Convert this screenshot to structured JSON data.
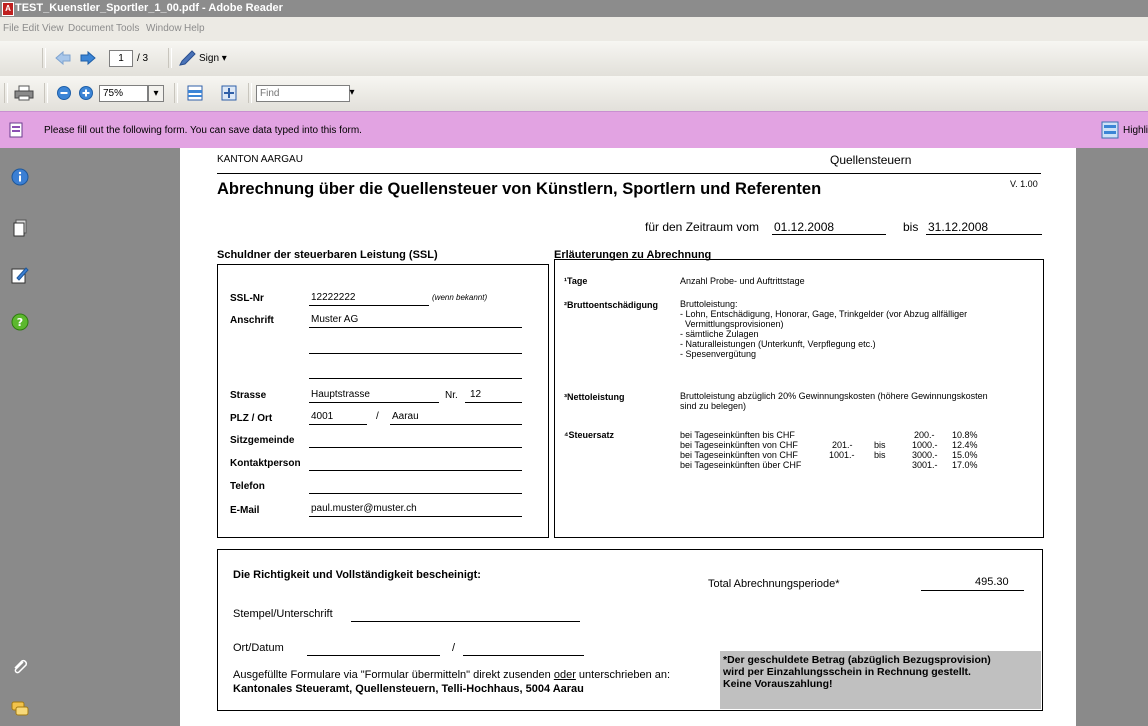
{
  "window": {
    "title": "TEST_Kuenstler_Sportler_1_00.pdf - Adobe Reader"
  },
  "menu": [
    "File",
    "Edit",
    "View",
    "Document",
    "Tools",
    "Window",
    "Help"
  ],
  "toolbar": {
    "page_current": "1",
    "page_total": "/ 3",
    "sign_label": "Sign",
    "zoom": "75%",
    "find_placeholder": "Find"
  },
  "notification": {
    "text": "Please fill out the following form. You can save data typed into this form.",
    "highlight_label": "Highli"
  },
  "form": {
    "canton": "KANTON AARGAU",
    "department": "Quellensteuern",
    "version": "V. 1.00",
    "title": "Abrechnung über die Quellensteuer von Künstlern, Sportlern und Referenten",
    "period_label": "für den Zeitraum vom",
    "period_from": "01.12.2008",
    "period_bis": "bis",
    "period_to": "31.12.2008",
    "debtor": {
      "heading": "Schuldner der steuerbaren Leistung (SSL)",
      "ssl_label": "SSL-Nr",
      "ssl_value": "12222222",
      "ssl_hint": "(wenn bekannt)",
      "address_label": "Anschrift",
      "address_value": "Muster AG",
      "street_label": "Strasse",
      "street_value": "Hauptstrasse",
      "nr_label": "Nr.",
      "nr_value": "12",
      "plz_label": "PLZ / Ort",
      "plz_value": "4001",
      "slash": "/",
      "city_value": "Aarau",
      "municipality_label": "Sitzgemeinde",
      "contact_label": "Kontaktperson",
      "phone_label": "Telefon",
      "email_label": "E-Mail",
      "email_value": "paul.muster@muster.ch"
    },
    "explanations": {
      "heading": "Erläuterungen zu Abrechnung",
      "tage_label": "¹Tage",
      "tage_text": "Anzahl Probe- und Auftrittstage",
      "brutto_label": "²Bruttoentschädigung",
      "brutto_lines": [
        "Bruttoleistung:",
        "- Lohn, Entschädigung, Honorar, Gage, Trinkgelder (vor Abzug allfälliger",
        "  Vermittlungsprovisionen)",
        "- sämtliche Zulagen",
        "- Naturalleistungen (Unterkunft, Verpflegung etc.)",
        "- Spesenvergütung"
      ],
      "netto_label": "³Nettoleistung",
      "netto_lines": [
        "Bruttoleistung abzüglich 20% Gewinnungskosten (höhere Gewinnungskosten",
        "sind zu belegen)"
      ],
      "steuer_label": "⁴Steuersatz",
      "rates": [
        {
          "text": "bei Tageseinkünften bis CHF",
          "from": "",
          "bis": "",
          "to": "200.-",
          "rate": "10.8%"
        },
        {
          "text": "bei Tageseinkünften von CHF",
          "from": "201.-",
          "bis": "bis",
          "to": "1000.-",
          "rate": "12.4%"
        },
        {
          "text": "bei Tageseinkünften von CHF",
          "from": "1001.-",
          "bis": "bis",
          "to": "3000.-",
          "rate": "15.0%"
        },
        {
          "text": "bei Tageseinkünften über CHF",
          "from": "",
          "bis": "",
          "to": "3001.-",
          "rate": "17.0%"
        }
      ]
    },
    "cert": {
      "heading": "Die Richtigkeit und Vollständigkeit bescheinigt:",
      "total_label": "Total Abrechnungsperiode*",
      "total_value": "495.30",
      "stamp_label": "Stempel/Unterschrift",
      "place_label": "Ort/Datum",
      "slash": "/",
      "send_pre": "Ausgefüllte Formulare via \"Formular übermitteln\" direkt zusenden ",
      "send_oder": "oder",
      "send_post": " unterschrieben an:",
      "address": "Kantonales Steueramt, Quellensteuern, Telli-Hochhaus, 5004 Aarau",
      "note_lines": [
        "*Der geschuldete Betrag (abzüglich Bezugsprovision)",
        "wird per Einzahlungsschein in Rechnung gestellt.",
        "Keine Vorauszahlung!"
      ]
    }
  }
}
